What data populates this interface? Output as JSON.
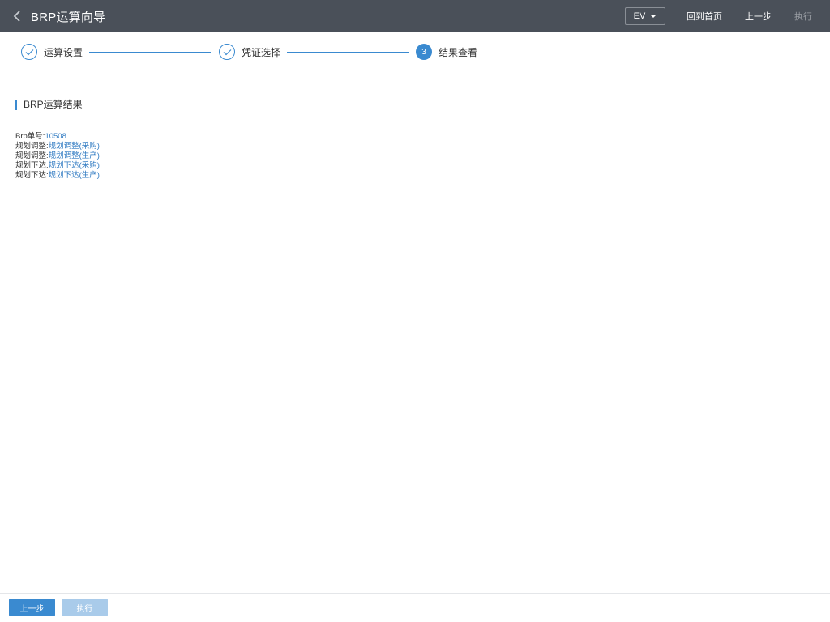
{
  "header": {
    "title": "BRP运算向导",
    "org_select": "EV",
    "home_label": "回到首页",
    "prev_label": "上一步",
    "exec_label": "执行"
  },
  "steps": [
    {
      "label": "运算设置",
      "status": "done"
    },
    {
      "label": "凭证选择",
      "status": "done"
    },
    {
      "label": "结果查看",
      "status": "active",
      "number": "3"
    }
  ],
  "section_title": "BRP运算结果",
  "results": [
    {
      "label": "Brp单号:",
      "value": "10508"
    },
    {
      "label": "规划调整:",
      "value": "规划调整(采购)"
    },
    {
      "label": "规划调整:",
      "value": "规划调整(生产)"
    },
    {
      "label": "规划下达:",
      "value": "规划下达(采购)"
    },
    {
      "label": "规划下达:",
      "value": "规划下达(生产)"
    }
  ],
  "footer": {
    "prev_label": "上一步",
    "exec_label": "执行"
  },
  "colors": {
    "header_bg": "#4a5059",
    "accent": "#3a8ad0",
    "link": "#2f7ac2",
    "disabled_btn": "#a9cbea"
  }
}
